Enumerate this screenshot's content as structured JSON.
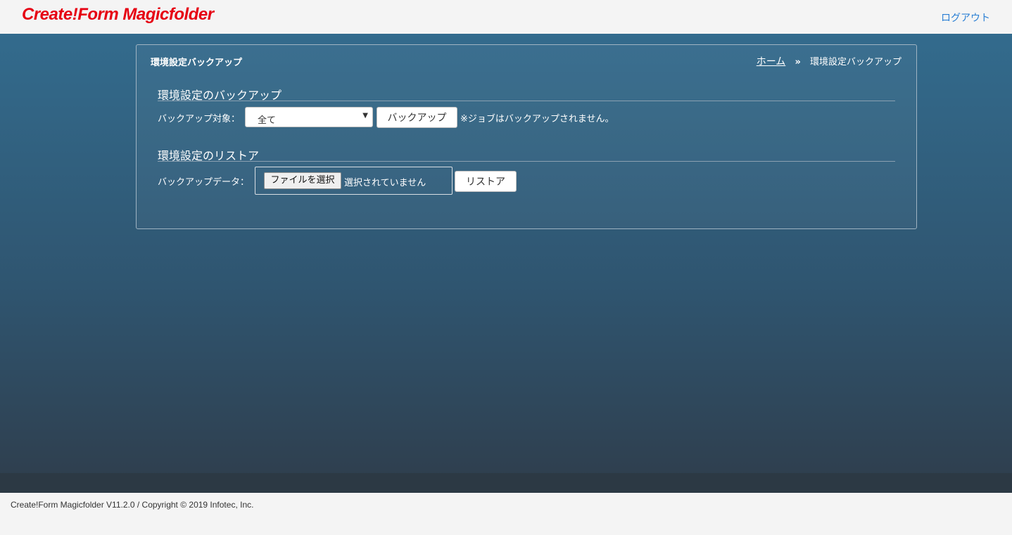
{
  "header": {
    "logo_text": "Create!Form Magicfolder",
    "logout_label": "ログアウト",
    "brand_color": "#e60012",
    "link_color": "#2a7fd4"
  },
  "panel": {
    "title": "環境設定バックアップ",
    "breadcrumb": {
      "home_label": "ホーム",
      "separator": "»",
      "current": "環境設定バックアップ"
    }
  },
  "backup": {
    "section_title": "環境設定のバックアップ",
    "target_label": "バックアップ対象：",
    "target_selected": "全て",
    "button_label": "バックアップ",
    "note": "※ジョブはバックアップされません。"
  },
  "restore": {
    "section_title": "環境設定のリストア",
    "data_label": "バックアップデータ：",
    "file_button_label": "ファイルを選択",
    "file_status": "選択されていません",
    "button_label": "リストア"
  },
  "footer": {
    "text": "Create!Form Magicfolder V11.2.0 / Copyright © 2019 Infotec, Inc."
  }
}
